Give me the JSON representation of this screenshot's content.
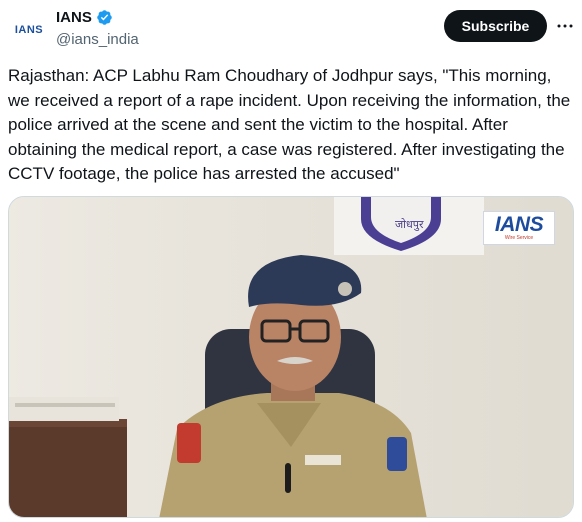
{
  "account": {
    "display_name": "IANS",
    "handle": "@ians_india",
    "avatar_text": "IANS",
    "verified": true
  },
  "actions": {
    "subscribe_label": "Subscribe",
    "more_icon": "more-horizontal-icon"
  },
  "tweet": {
    "text": "Rajasthan: ACP Labhu Ram Choudhary of Jodhpur says, \"This morning, we received a report of a rape incident. Upon receiving the information, the police arrived at the scene and sent the victim to the hospital. After obtaining the medical report, a case was registered. After investigating the CCTV footage, the police has arrested the accused\""
  },
  "media": {
    "watermark": "IANS",
    "watermark_sub": "Wire Service",
    "emblem_text": "जोधपुर"
  },
  "colors": {
    "verified": "#1d9bf0",
    "button_bg": "#0f1419",
    "brand_blue": "#1d4c9e",
    "secondary_text": "#536471"
  }
}
